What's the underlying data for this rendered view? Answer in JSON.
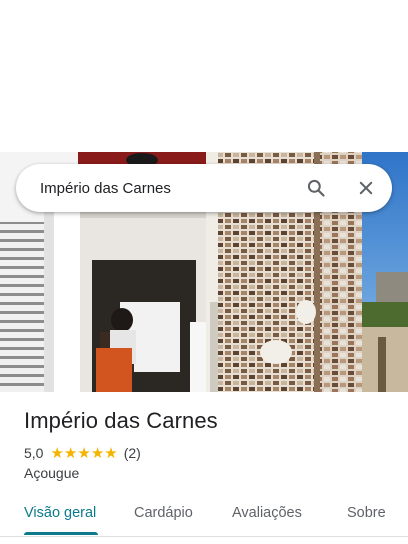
{
  "search": {
    "query": "Império das Carnes"
  },
  "place": {
    "name": "Império das Carnes",
    "rating": "5,0",
    "stars": 5,
    "review_count": "(2)",
    "category": "Açougue"
  },
  "tabs": [
    {
      "label": "Visão geral",
      "active": true
    },
    {
      "label": "Cardápio",
      "active": false
    },
    {
      "label": "Avaliações",
      "active": false
    },
    {
      "label": "Sobre",
      "active": false
    }
  ],
  "colors": {
    "accent": "#0b7a8a",
    "star": "#f4b400"
  },
  "icons": [
    "search-icon",
    "close-icon",
    "star-icon"
  ]
}
